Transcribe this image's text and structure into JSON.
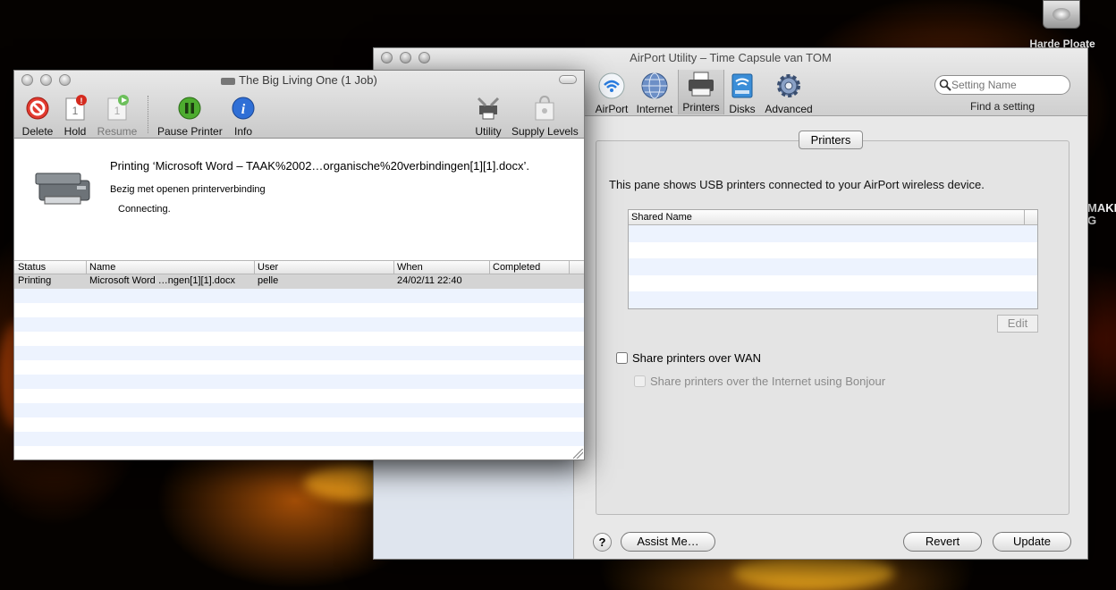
{
  "desktop": {
    "drive_label": "Harde Ploate",
    "edge_text": [
      "MAKE",
      "G"
    ]
  },
  "airport": {
    "title": "AirPort Utility – Time Capsule van TOM",
    "toolbar": [
      {
        "label": "AirPort",
        "icon": "wifi-icon"
      },
      {
        "label": "Internet",
        "icon": "globe-icon"
      },
      {
        "label": "Printers",
        "icon": "printer-icon",
        "selected": true
      },
      {
        "label": "Disks",
        "icon": "disk-icon"
      },
      {
        "label": "Advanced",
        "icon": "gear-icon"
      }
    ],
    "search_placeholder": "Setting Name",
    "find_label": "Find a setting",
    "tab_label": "Printers",
    "description": "This pane shows USB printers connected to your AirPort wireless device.",
    "shared_table_header": "Shared Name",
    "edit_label": "Edit",
    "share_wan_label": "Share printers over WAN",
    "share_bonjour_label": "Share printers over the Internet using Bonjour",
    "help_label": "?",
    "assist_label": "Assist Me…",
    "revert_label": "Revert",
    "update_label": "Update"
  },
  "queue": {
    "title": "The Big Living One (1 Job)",
    "toolbar": {
      "delete": "Delete",
      "hold": "Hold",
      "resume": "Resume",
      "pause": "Pause Printer",
      "info": "Info",
      "utility": "Utility",
      "supply": "Supply Levels"
    },
    "job_title": "Printing ‘Microsoft Word – TAAK%2002…organische%20verbindingen[1][1].docx’.",
    "job_sub": "Bezig met openen printerverbinding",
    "job_status": "Connecting.",
    "columns": [
      "Status",
      "Name",
      "User",
      "When",
      "Completed"
    ],
    "rows": [
      {
        "status": "Printing",
        "name": "Microsoft Word …ngen[1][1].docx",
        "user": "pelle",
        "when": "24/02/11 22:40",
        "completed": ""
      }
    ]
  }
}
